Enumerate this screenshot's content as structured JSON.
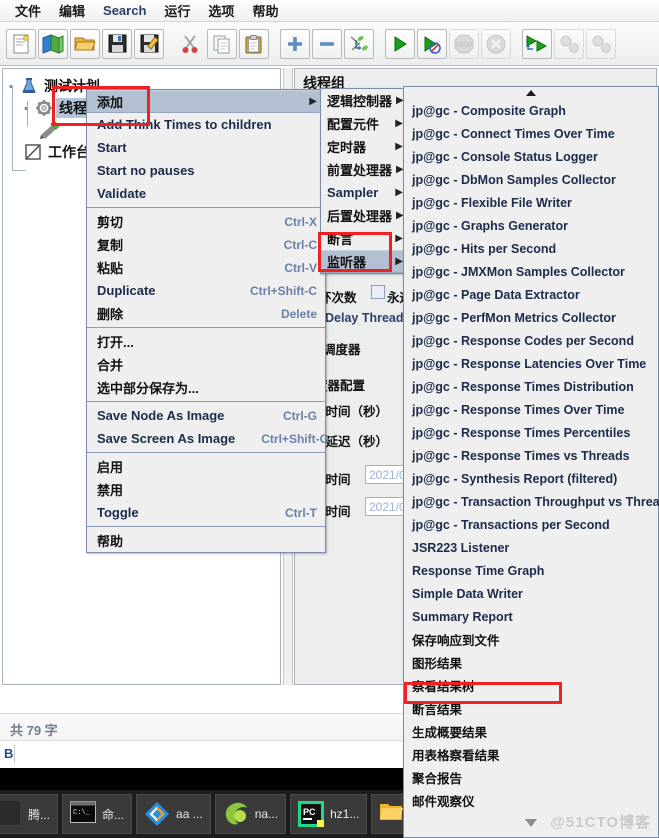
{
  "menubar": {
    "items": [
      {
        "label": "文件",
        "lang": "cn"
      },
      {
        "label": "编辑",
        "lang": "cn"
      },
      {
        "label": "Search",
        "lang": "en"
      },
      {
        "label": "运行",
        "lang": "cn"
      },
      {
        "label": "选项",
        "lang": "cn"
      },
      {
        "label": "帮助",
        "lang": "cn"
      }
    ]
  },
  "toolbar": {
    "buttons": [
      {
        "name": "new-icon"
      },
      {
        "name": "templates-icon"
      },
      {
        "name": "open-icon"
      },
      {
        "name": "save-icon"
      },
      {
        "name": "save-as-icon"
      },
      {
        "name": "cut-icon"
      },
      {
        "name": "copy-icon"
      },
      {
        "name": "paste-icon"
      },
      {
        "name": "expand-all-icon"
      },
      {
        "name": "collapse-all-icon"
      },
      {
        "name": "toggle-icon"
      },
      {
        "name": "start-icon"
      },
      {
        "name": "start-no-pauses-icon"
      },
      {
        "name": "stop-icon"
      },
      {
        "name": "shutdown-icon"
      },
      {
        "name": "remote-start-all-icon"
      },
      {
        "name": "remote-stop-all-icon"
      },
      {
        "name": "remote-shutdown-all-icon"
      }
    ]
  },
  "tree": {
    "nodes": [
      {
        "label": "测试计划",
        "icon": "test-plan-icon",
        "selected": false
      },
      {
        "label": "线程组",
        "icon": "thread-group-icon",
        "selected": true
      },
      {
        "label": "工作台",
        "icon": "workbench-icon",
        "selected": false
      }
    ]
  },
  "right_panel": {
    "title": "线程组",
    "form_labels": [
      "环次数",
      "永远",
      "Delay Thread",
      "调度器",
      "度器配置",
      "续时间（秒）",
      "动延迟（秒）",
      "动时间",
      "束时间"
    ],
    "date_values": [
      "2021/0",
      "2021/0"
    ]
  },
  "context_menu": {
    "items": [
      {
        "label": "添加",
        "accel": "",
        "submenu": true,
        "selected": true,
        "lang": "cn"
      },
      {
        "label": "Add Think Times to children",
        "accel": "",
        "submenu": false,
        "selected": false,
        "lang": "en"
      },
      {
        "label": "Start",
        "accel": "",
        "submenu": false,
        "selected": false,
        "lang": "en"
      },
      {
        "label": "Start no pauses",
        "accel": "",
        "submenu": false,
        "selected": false,
        "lang": "en"
      },
      {
        "label": "Validate",
        "accel": "",
        "submenu": false,
        "selected": false,
        "lang": "en"
      },
      {
        "separator": true
      },
      {
        "label": "剪切",
        "accel": "Ctrl-X",
        "submenu": false,
        "selected": false,
        "lang": "cn"
      },
      {
        "label": "复制",
        "accel": "Ctrl-C",
        "submenu": false,
        "selected": false,
        "lang": "cn"
      },
      {
        "label": "粘贴",
        "accel": "Ctrl-V",
        "submenu": false,
        "selected": false,
        "lang": "cn"
      },
      {
        "label": "Duplicate",
        "accel": "Ctrl+Shift-C",
        "submenu": false,
        "selected": false,
        "lang": "en"
      },
      {
        "label": "删除",
        "accel": "Delete",
        "submenu": false,
        "selected": false,
        "lang": "cn"
      },
      {
        "separator": true
      },
      {
        "label": "打开...",
        "accel": "",
        "submenu": false,
        "selected": false,
        "lang": "cn"
      },
      {
        "label": "合并",
        "accel": "",
        "submenu": false,
        "selected": false,
        "lang": "cn"
      },
      {
        "label": "选中部分保存为...",
        "accel": "",
        "submenu": false,
        "selected": false,
        "lang": "cn"
      },
      {
        "separator": true
      },
      {
        "label": "Save Node As Image",
        "accel": "Ctrl-G",
        "submenu": false,
        "selected": false,
        "lang": "en"
      },
      {
        "label": "Save Screen As Image",
        "accel": "Ctrl+Shift-G",
        "submenu": false,
        "selected": false,
        "lang": "en"
      },
      {
        "separator": true
      },
      {
        "label": "启用",
        "accel": "",
        "submenu": false,
        "selected": false,
        "disabled": true,
        "lang": "cn"
      },
      {
        "label": "禁用",
        "accel": "",
        "submenu": false,
        "selected": false,
        "lang": "cn"
      },
      {
        "label": "Toggle",
        "accel": "Ctrl-T",
        "submenu": false,
        "selected": false,
        "lang": "en"
      },
      {
        "separator": true
      },
      {
        "label": "帮助",
        "accel": "",
        "submenu": false,
        "selected": false,
        "lang": "cn"
      }
    ]
  },
  "add_submenu": {
    "items": [
      {
        "label": "逻辑控制器",
        "submenu": true,
        "selected": false,
        "lang": "cn"
      },
      {
        "label": "配置元件",
        "submenu": true,
        "selected": false,
        "lang": "cn"
      },
      {
        "label": "定时器",
        "submenu": true,
        "selected": false,
        "lang": "cn"
      },
      {
        "label": "前置处理器",
        "submenu": true,
        "selected": false,
        "lang": "cn"
      },
      {
        "label": "Sampler",
        "submenu": true,
        "selected": false,
        "lang": "en"
      },
      {
        "label": "后置处理器",
        "submenu": true,
        "selected": false,
        "lang": "cn"
      },
      {
        "label": "断言",
        "submenu": true,
        "selected": false,
        "lang": "cn"
      },
      {
        "label": "监听器",
        "submenu": true,
        "selected": true,
        "lang": "cn"
      }
    ]
  },
  "listener_submenu": {
    "scroll_up": "scroll-up-arrow",
    "scroll_down": "scroll-down-arrow",
    "items": [
      {
        "label": "jp@gc - Composite Graph",
        "highlighted": false
      },
      {
        "label": "jp@gc - Connect Times Over Time",
        "highlighted": false
      },
      {
        "label": "jp@gc - Console Status Logger",
        "highlighted": false
      },
      {
        "label": "jp@gc - DbMon Samples Collector",
        "highlighted": false
      },
      {
        "label": "jp@gc - Flexible File Writer",
        "highlighted": false
      },
      {
        "label": "jp@gc - Graphs Generator",
        "highlighted": false
      },
      {
        "label": "jp@gc - Hits per Second",
        "highlighted": false
      },
      {
        "label": "jp@gc - JMXMon Samples Collector",
        "highlighted": false
      },
      {
        "label": "jp@gc - Page Data Extractor",
        "highlighted": false
      },
      {
        "label": "jp@gc - PerfMon Metrics Collector",
        "highlighted": false
      },
      {
        "label": "jp@gc - Response Codes per Second",
        "highlighted": false
      },
      {
        "label": "jp@gc - Response Latencies Over Time",
        "highlighted": false
      },
      {
        "label": "jp@gc - Response Times Distribution",
        "highlighted": false
      },
      {
        "label": "jp@gc - Response Times Over Time",
        "highlighted": false
      },
      {
        "label": "jp@gc - Response Times Percentiles",
        "highlighted": false
      },
      {
        "label": "jp@gc - Response Times vs Threads",
        "highlighted": false
      },
      {
        "label": "jp@gc - Synthesis Report (filtered)",
        "highlighted": false
      },
      {
        "label": "jp@gc - Transaction Throughput vs Threads",
        "highlighted": false
      },
      {
        "label": "jp@gc - Transactions per Second",
        "highlighted": false
      },
      {
        "label": "JSR223 Listener",
        "highlighted": false
      },
      {
        "label": "Response Time Graph",
        "highlighted": false
      },
      {
        "label": "Simple Data Writer",
        "highlighted": false
      },
      {
        "label": "Summary Report",
        "highlighted": false
      },
      {
        "label": "保存响应到文件",
        "highlighted": false
      },
      {
        "label": "图形结果",
        "highlighted": false
      },
      {
        "label": "察看结果树",
        "highlighted": true
      },
      {
        "label": "断言结果",
        "highlighted": false
      },
      {
        "label": "生成概要结果",
        "highlighted": false
      },
      {
        "label": "用表格察看结果",
        "highlighted": false
      },
      {
        "label": "聚合报告",
        "highlighted": false
      },
      {
        "label": "邮件观察仪",
        "highlighted": false
      }
    ]
  },
  "statusbar": {
    "text": "共 79 字"
  },
  "ime_bar": {
    "text": "B"
  },
  "taskbar": {
    "items": [
      {
        "label": "腾...",
        "icon": "tencent-icon"
      },
      {
        "label": "命...",
        "icon": "cmd-icon"
      },
      {
        "label": "aa ...",
        "icon": "vmware-icon"
      },
      {
        "label": "na...",
        "icon": "navicat-icon"
      },
      {
        "label": "hz1...",
        "icon": "pycharm-icon"
      },
      {
        "label": "",
        "icon": "folder-icon"
      }
    ]
  },
  "watermark": {
    "text": "@51CTO博客"
  },
  "colors": {
    "menu_bg": "#efefef",
    "menu_border": "#7a8ca6",
    "selected": "#b2c0d2",
    "tree_selected": "#b6c7da",
    "accel_text": "#6a7fa8",
    "annotation_red": "#ee2222",
    "taskbar_bg": "#1d1d1d"
  }
}
